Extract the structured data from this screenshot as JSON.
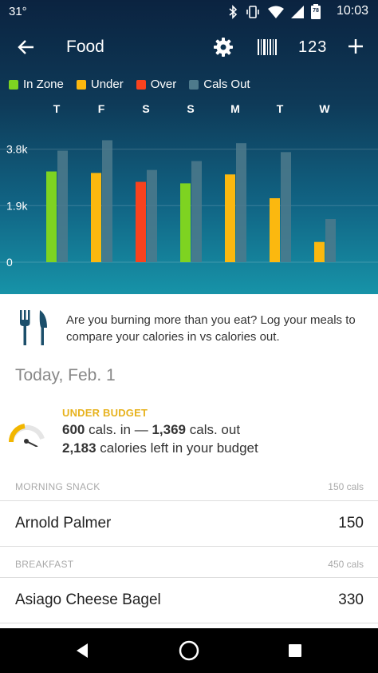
{
  "status_bar": {
    "temperature": "31°",
    "time": "10:03",
    "battery_level": "78"
  },
  "toolbar": {
    "title": "Food",
    "icons": [
      "back-arrow-icon",
      "gear-icon",
      "barcode-icon",
      "quick-calories-icon",
      "plus-icon"
    ],
    "quick_calories_label": "123"
  },
  "legend": [
    {
      "label": "In Zone",
      "color": "#7ed321"
    },
    {
      "label": "Under",
      "color": "#fbb80f"
    },
    {
      "label": "Over",
      "color": "#f8421e"
    },
    {
      "label": "Cals Out",
      "color": "#4e7a8c"
    }
  ],
  "chart_data": {
    "type": "bar",
    "categories": [
      "T",
      "F",
      "S",
      "S",
      "M",
      "T",
      "W"
    ],
    "series": [
      {
        "values": [
          3050,
          3000,
          2700,
          2650,
          2950,
          2150,
          680
        ],
        "statuses": [
          "in_zone",
          "under",
          "over",
          "in_zone",
          "under",
          "under",
          "under"
        ]
      },
      {
        "name": "Cals Out",
        "values": [
          3750,
          4100,
          3100,
          3400,
          4000,
          3700,
          1450
        ]
      }
    ],
    "y_ticks": [
      {
        "label": "3.8k",
        "value": 3800
      },
      {
        "label": "1.9k",
        "value": 1900
      },
      {
        "label": "0",
        "value": 0
      }
    ],
    "ylim": [
      0,
      4300
    ],
    "grid": true
  },
  "info": {
    "text": "Are you burning more than you eat? Log your meals to compare your calories in vs calories out."
  },
  "day": {
    "title": "Today, Feb. 1"
  },
  "budget": {
    "status": "UNDER BUDGET",
    "cals_in": "600",
    "cals_in_suffix": " cals. in — ",
    "cals_out": "1,369",
    "cals_out_suffix": " cals. out",
    "left": "2,183",
    "left_suffix": " calories left in your budget"
  },
  "meals": [
    {
      "name": "MORNING SNACK",
      "total": "150 cals",
      "items": [
        {
          "name": "Arnold Palmer",
          "cals": "150"
        }
      ]
    },
    {
      "name": "BREAKFAST",
      "total": "450 cals",
      "items": [
        {
          "name": "Asiago Cheese Bagel",
          "cals": "330"
        }
      ]
    }
  ]
}
